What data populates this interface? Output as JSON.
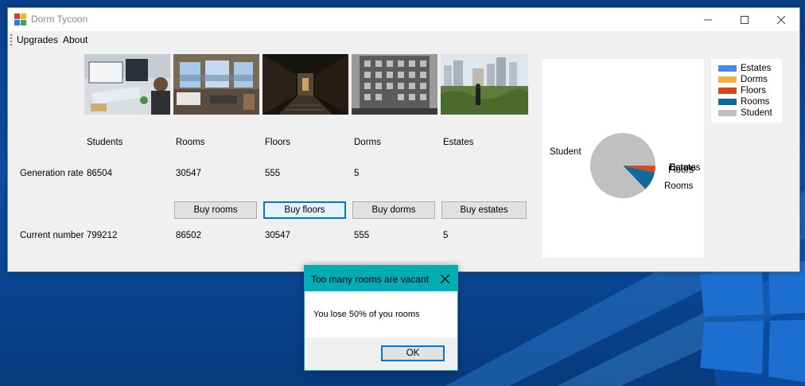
{
  "window": {
    "title": "Dorm Tycoon",
    "menu": [
      "Upgrades",
      "About"
    ]
  },
  "columns": {
    "headers": [
      "Students",
      "Rooms",
      "Floors",
      "Dorms",
      "Estates"
    ],
    "generation_label": "Generation rate",
    "generation_values": [
      "86504",
      "30547",
      "555",
      "5",
      ""
    ],
    "current_label": "Current number",
    "current_values": [
      "799212",
      "86502",
      "30547",
      "555",
      "5"
    ],
    "buy_buttons": [
      "Buy rooms",
      "Buy floors",
      "Buy dorms",
      "Buy estates"
    ],
    "photos": [
      "office-worker-photo",
      "hotel-room-photo",
      "dark-hallway-photo",
      "apartment-building-photo",
      "city-towers-photo"
    ]
  },
  "chart_data": {
    "type": "pie",
    "series": [
      {
        "name": "Estates",
        "value": 5,
        "color": "#4a89e8"
      },
      {
        "name": "Dorms",
        "value": 555,
        "color": "#f4b03c"
      },
      {
        "name": "Floors",
        "value": 30547,
        "color": "#d9471b"
      },
      {
        "name": "Rooms",
        "value": 86502,
        "color": "#0f6a9a"
      },
      {
        "name": "Student",
        "value": 799212,
        "color": "#c0c0c0"
      }
    ],
    "slice_labels": [
      "Student",
      "Estates",
      "Dorms",
      "Floors",
      "Rooms"
    ],
    "legend": [
      "Estates",
      "Dorms",
      "Floors",
      "Rooms",
      "Student"
    ],
    "legend_placement": "right"
  },
  "dialog": {
    "title": "Too many rooms are vacant",
    "message": "You lose 50% of you rooms",
    "ok_label": "OK"
  },
  "colors": {
    "dialog_title_bg": "#00adb5",
    "focus_border": "#0078d7"
  }
}
